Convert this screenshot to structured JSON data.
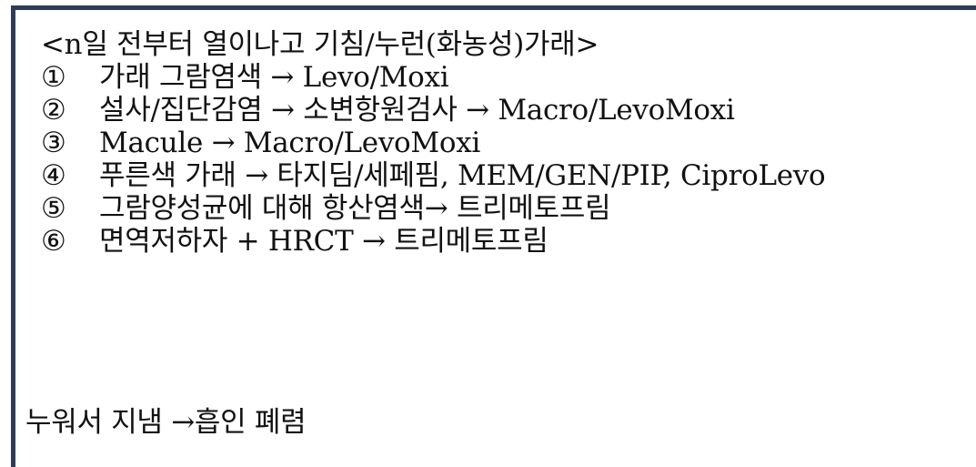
{
  "note": {
    "title": "<n일 전부터 열이나고 기침/누런(화농성)가래>",
    "items": [
      {
        "number": "①",
        "text": "가래 그람염색 → Levo/Moxi"
      },
      {
        "number": "②",
        "text": "설사/집단감염 → 소변항원검사 → Macro/LevoMoxi"
      },
      {
        "number": "③",
        "text": "Macule → Macro/LevoMoxi"
      },
      {
        "number": "④",
        "text": "푸른색 가래 → 타지딤/세페핌, MEM/GEN/PIP, CiproLevo"
      },
      {
        "number": "⑤",
        "text": "그람양성균에 대해 항산염색→ 트리메토프림"
      },
      {
        "number": "⑥",
        "text": "면역저하자 + HRCT → 트리메토프림"
      }
    ],
    "footer": "누워서 지냄 →흡인 폐렴"
  },
  "colors": {
    "border": "#2e3d55",
    "text": "#111111",
    "background": "#ffffff"
  }
}
